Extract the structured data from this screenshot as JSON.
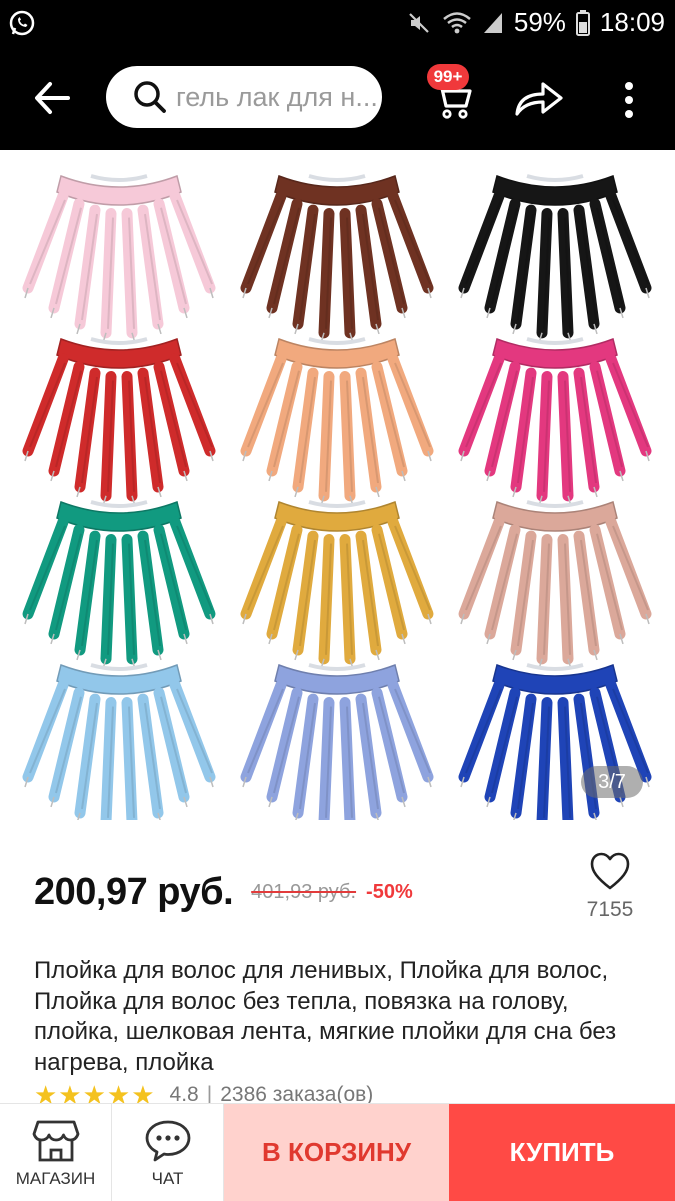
{
  "status_bar": {
    "battery": "59%",
    "time": "18:09",
    "icons": [
      "whatsapp-icon",
      "mute-icon",
      "wifi-icon",
      "signal-icon",
      "battery-icon"
    ]
  },
  "header": {
    "search_placeholder": "гель лак для н...",
    "cart_badge": "99+",
    "icons": [
      "back-arrow-icon",
      "search-icon",
      "cart-icon",
      "share-icon",
      "more-icon"
    ]
  },
  "gallery": {
    "counter": "3/7",
    "variants": [
      {
        "name": "pink",
        "color": "#f6c9d8"
      },
      {
        "name": "brown",
        "color": "#6f3222"
      },
      {
        "name": "black",
        "color": "#161616"
      },
      {
        "name": "red",
        "color": "#cf2b2b"
      },
      {
        "name": "peach",
        "color": "#f1a97e"
      },
      {
        "name": "magenta",
        "color": "#e3387f"
      },
      {
        "name": "teal",
        "color": "#119a80"
      },
      {
        "name": "mustard",
        "color": "#e0aa3e"
      },
      {
        "name": "dusty-rose",
        "color": "#dba89a"
      },
      {
        "name": "light-blue",
        "color": "#92c7ea"
      },
      {
        "name": "periwinkle",
        "color": "#8ea3de"
      },
      {
        "name": "royal-blue",
        "color": "#1f44b7"
      }
    ]
  },
  "product": {
    "price": "200,97 руб.",
    "old_price": "401,93 руб.",
    "discount": "-50%",
    "wishlist_count": "7155",
    "title": "Плойка для волос для ленивых, Плойка для волос, Плойка для волос без тепла, повязка на голову, плойка, шелковая лента, мягкие плойки для сна без нагрева, плойка",
    "rating": "4.8",
    "orders": "2386 заказа(ов)",
    "stars": "★★★★★"
  },
  "bottom_bar": {
    "store_label": "МАГАЗИН",
    "chat_label": "ЧАТ",
    "cart_button": "В КОРЗИНУ",
    "buy_button": "КУПИТЬ"
  },
  "colors": {
    "accent": "#f0393b",
    "cart_button_bg": "#ffd2cd",
    "buy_button_bg": "#ff4a45",
    "star": "#f4c21f"
  }
}
